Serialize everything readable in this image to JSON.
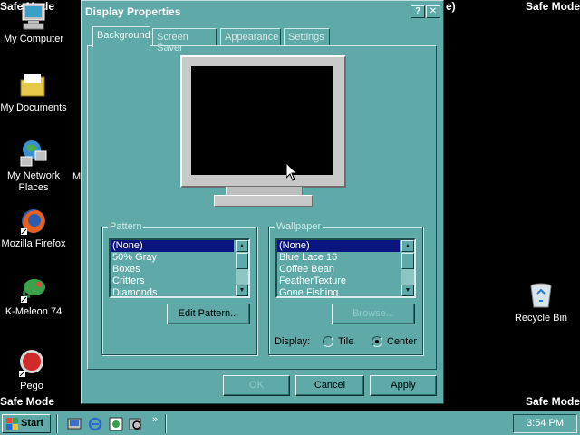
{
  "desktop": {
    "safe_mode_label": "Safe Mode",
    "partial_label_right": "e)",
    "partial_label_left": "M",
    "icons": [
      {
        "label": "My Computer",
        "icon": "computer-icon"
      },
      {
        "label": "My Documents",
        "icon": "folder-icon"
      },
      {
        "label": "My Network Places",
        "icon": "network-icon"
      },
      {
        "label": "Mozilla Firefox",
        "icon": "firefox-icon"
      },
      {
        "label": "K-Meleon 74",
        "icon": "kmeleon-icon"
      },
      {
        "label": "Pego",
        "icon": "pego-icon"
      },
      {
        "label": "Recycle Bin",
        "icon": "recycle-bin-icon"
      }
    ]
  },
  "dialog": {
    "title": "Display Properties",
    "help_glyph": "?",
    "close_glyph": "✕",
    "tabs": [
      "Background",
      "Screen Saver",
      "Appearance",
      "Settings"
    ],
    "pattern": {
      "label": "Pattern",
      "items": [
        "(None)",
        "50% Gray",
        "Boxes",
        "Critters",
        "Diamonds"
      ],
      "selected": "(None)",
      "edit_button": "Edit Pattern..."
    },
    "wallpaper": {
      "label": "Wallpaper",
      "items": [
        "(None)",
        "Blue Lace 16",
        "Coffee Bean",
        "FeatherTexture",
        "Gone Fishing"
      ],
      "selected": "(None)",
      "browse_button": "Browse...",
      "display_label": "Display:",
      "display_options": [
        "Tile",
        "Center"
      ],
      "display_selected": "Center"
    },
    "buttons": {
      "ok": "OK",
      "cancel": "Cancel",
      "apply": "Apply"
    }
  },
  "taskbar": {
    "start_label": "Start",
    "clock": "3:54 PM",
    "chevron": "»"
  },
  "colors": {
    "window": "#5fa9a8",
    "selection": "#0b1580",
    "desktop": "#000000"
  }
}
